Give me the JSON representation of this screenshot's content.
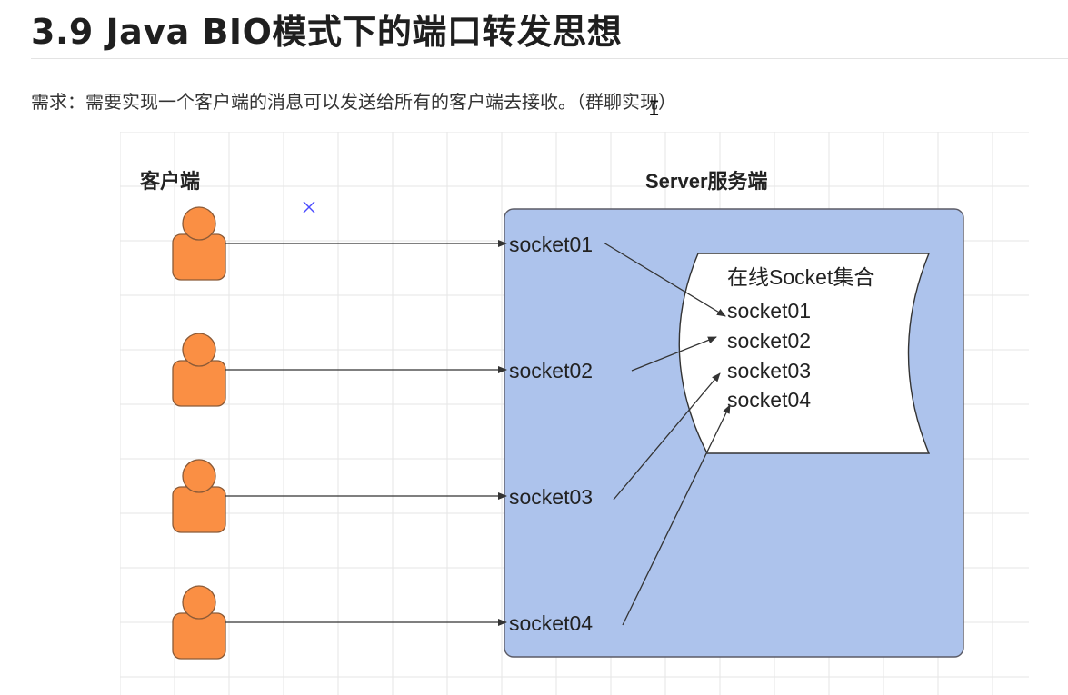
{
  "page": {
    "title": "3.9 Java BIO模式下的端口转发思想",
    "requirement": "需求：需要实现一个客户端的消息可以发送给所有的客户端去接收。（群聊实现）"
  },
  "diagram": {
    "client_label": "客户端",
    "server_label": "Server服务端",
    "collection_title": "在线Socket集合",
    "server_sockets": [
      "socket01",
      "socket02",
      "socket03",
      "socket04"
    ],
    "collection_sockets": [
      "socket01",
      "socket02",
      "socket03",
      "socket04"
    ],
    "colors": {
      "client": "#fa8f44",
      "client_stroke": "#8a5a37",
      "server_fill": "#adc3ec",
      "server_stroke": "#5b5b66",
      "grid": "#e6e6e6",
      "arrow": "#333333",
      "close_mark": "#4a4aff"
    },
    "icons": {
      "client": "user-icon",
      "marker": "close-icon"
    }
  }
}
